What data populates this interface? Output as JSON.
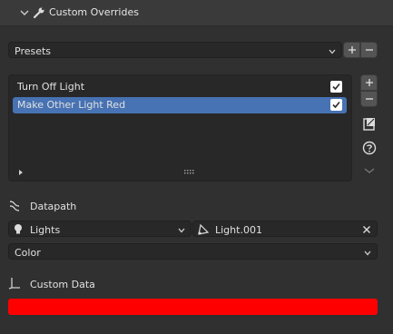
{
  "panel": {
    "title": "Custom Overrides"
  },
  "presets": {
    "label": "Presets"
  },
  "list": {
    "items": [
      {
        "label": "Turn Off Light",
        "checked": true,
        "selected": false
      },
      {
        "label": "Make Other Light Red",
        "checked": true,
        "selected": true
      }
    ]
  },
  "datapath": {
    "label": "Datapath",
    "type_value": "Lights",
    "object_value": "Light.001",
    "property_value": "Color"
  },
  "custom_data": {
    "label": "Custom Data",
    "color": "#ff0000"
  },
  "colors": {
    "accent": "#4772b3",
    "background": "#303030",
    "field": "#282828"
  },
  "icons": [
    "chevron-down-icon",
    "wrench-icon",
    "plus-icon",
    "minus-icon",
    "expand-icon",
    "drag-handle-icon",
    "duplicate-icon",
    "help-icon",
    "lightbulb-icon",
    "datapath-icon",
    "object-icon",
    "close-icon",
    "custom-data-icon"
  ]
}
